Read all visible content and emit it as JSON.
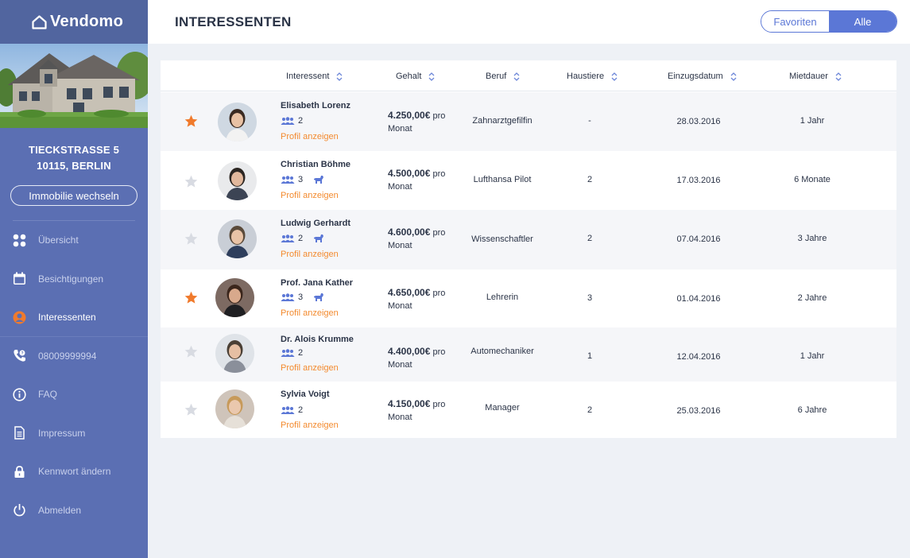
{
  "app": {
    "brand": "Vendomo"
  },
  "property": {
    "street": "TIECKSTRASSE 5",
    "city": "10115, BERLIN",
    "switch_label": "Immobilie wechseln"
  },
  "nav": [
    {
      "label": "Übersicht",
      "icon": "grid-icon",
      "active": false
    },
    {
      "label": "Besichtigungen",
      "icon": "calendar-icon",
      "active": false
    },
    {
      "label": "Interessenten",
      "icon": "person-icon",
      "active": true
    },
    {
      "label": "08009999994",
      "icon": "phone-icon",
      "active": false
    },
    {
      "label": "FAQ",
      "icon": "info-icon",
      "active": false
    },
    {
      "label": "Impressum",
      "icon": "document-icon",
      "active": false
    },
    {
      "label": "Kennwort ändern",
      "icon": "lock-icon",
      "active": false
    },
    {
      "label": "Abmelden",
      "icon": "power-icon",
      "active": false
    }
  ],
  "header": {
    "title": "INTERESSENTEN",
    "toggle": {
      "favorites": "Favoriten",
      "all": "Alle",
      "selected": "all"
    }
  },
  "table": {
    "columns": [
      "Interessent",
      "Gehalt",
      "Beruf",
      "Haustiere",
      "Einzugsdatum",
      "Mietdauer"
    ],
    "profile_link_label": "Profil anzeigen",
    "salary_suffix_1": "pro",
    "salary_suffix_2": "Monat",
    "rows": [
      {
        "favorite": true,
        "name": "Elisabeth Lorenz",
        "persons": "2",
        "has_dog": false,
        "salary": "4.250,00€",
        "job": "Zahnarztgefilfin",
        "pets": "-",
        "move_in": "28.03.2016",
        "duration": "1 Jahr"
      },
      {
        "favorite": false,
        "name": "Christian Böhme",
        "persons": "3",
        "has_dog": true,
        "salary": "4.500,00€",
        "job": "Lufthansa Pilot",
        "pets": "2",
        "move_in": "17.03.2016",
        "duration": "6 Monate"
      },
      {
        "favorite": false,
        "name": "Ludwig Gerhardt",
        "persons": "2",
        "has_dog": true,
        "salary": "4.600,00€",
        "job": "Wissenschaftler",
        "pets": "2",
        "move_in": "07.04.2016",
        "duration": "3 Jahre"
      },
      {
        "favorite": true,
        "name": "Prof. Jana Kather",
        "persons": "3",
        "has_dog": true,
        "salary": "4.650,00€",
        "job": "Lehrerin",
        "pets": "3",
        "move_in": "01.04.2016",
        "duration": "2 Jahre"
      },
      {
        "favorite": false,
        "name": "Dr. Alois Krumme",
        "persons": "2",
        "has_dog": false,
        "salary": "4.400,00€",
        "job": "Automechaniker",
        "pets": "1",
        "move_in": "12.04.2016",
        "duration": "1 Jahr"
      },
      {
        "favorite": false,
        "name": "Sylvia Voigt",
        "persons": "2",
        "has_dog": false,
        "salary": "4.150,00€",
        "job": "Manager",
        "pets": "2",
        "move_in": "25.03.2016",
        "duration": "6 Jahre"
      }
    ]
  },
  "colors": {
    "sidebar": "#5b6fb3",
    "accent": "#5b77d6",
    "star_active": "#f07a2c",
    "star_inactive": "#d8dbe2",
    "link": "#f38a2e"
  }
}
